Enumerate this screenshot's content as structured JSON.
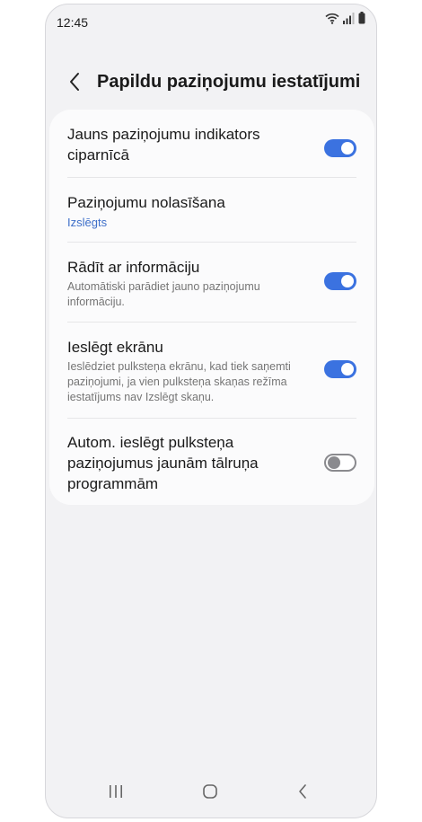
{
  "status_bar": {
    "time": "12:45"
  },
  "header": {
    "title": "Papildu paziņojumu iestatījumi"
  },
  "settings": [
    {
      "title_line1": "Jauns paziņojumu indikators",
      "title_line2": "ciparnīcā",
      "toggle": "on"
    },
    {
      "title_line1": "Paziņojumu nolasīšana",
      "subtitle": "Izslēgts"
    },
    {
      "title_line1": "Rādīt ar informāciju",
      "sub_line1": "Automātiski parādiet jauno paziņojumu",
      "sub_line2": "informāciju.",
      "toggle": "on"
    },
    {
      "title_line1": "Ieslēgt ekrānu",
      "sub_line1": "Ieslēdziet pulksteņa ekrānu, kad tiek saņemti",
      "sub_line2": "paziņojumi, ja vien pulksteņa skaņas režīma",
      "sub_line3": "iestatījums nav Izslēgt skaņu.",
      "toggle": "on"
    },
    {
      "title_line1": "Autom. ieslēgt pulksteņa",
      "title_line2": "paziņojumus jaunām tālruņa",
      "title_line3": "programmām",
      "toggle": "off"
    }
  ],
  "colors": {
    "accent": "#3b72e0",
    "link": "#3e6fc9",
    "background": "#f2f2f4"
  },
  "icons": {
    "back": "chevron-left-icon",
    "wifi": "wifi-icon",
    "signal": "signal-icon",
    "battery": "battery-icon",
    "recents": "recents-icon",
    "home": "home-icon",
    "nav_back": "nav-back-icon"
  }
}
